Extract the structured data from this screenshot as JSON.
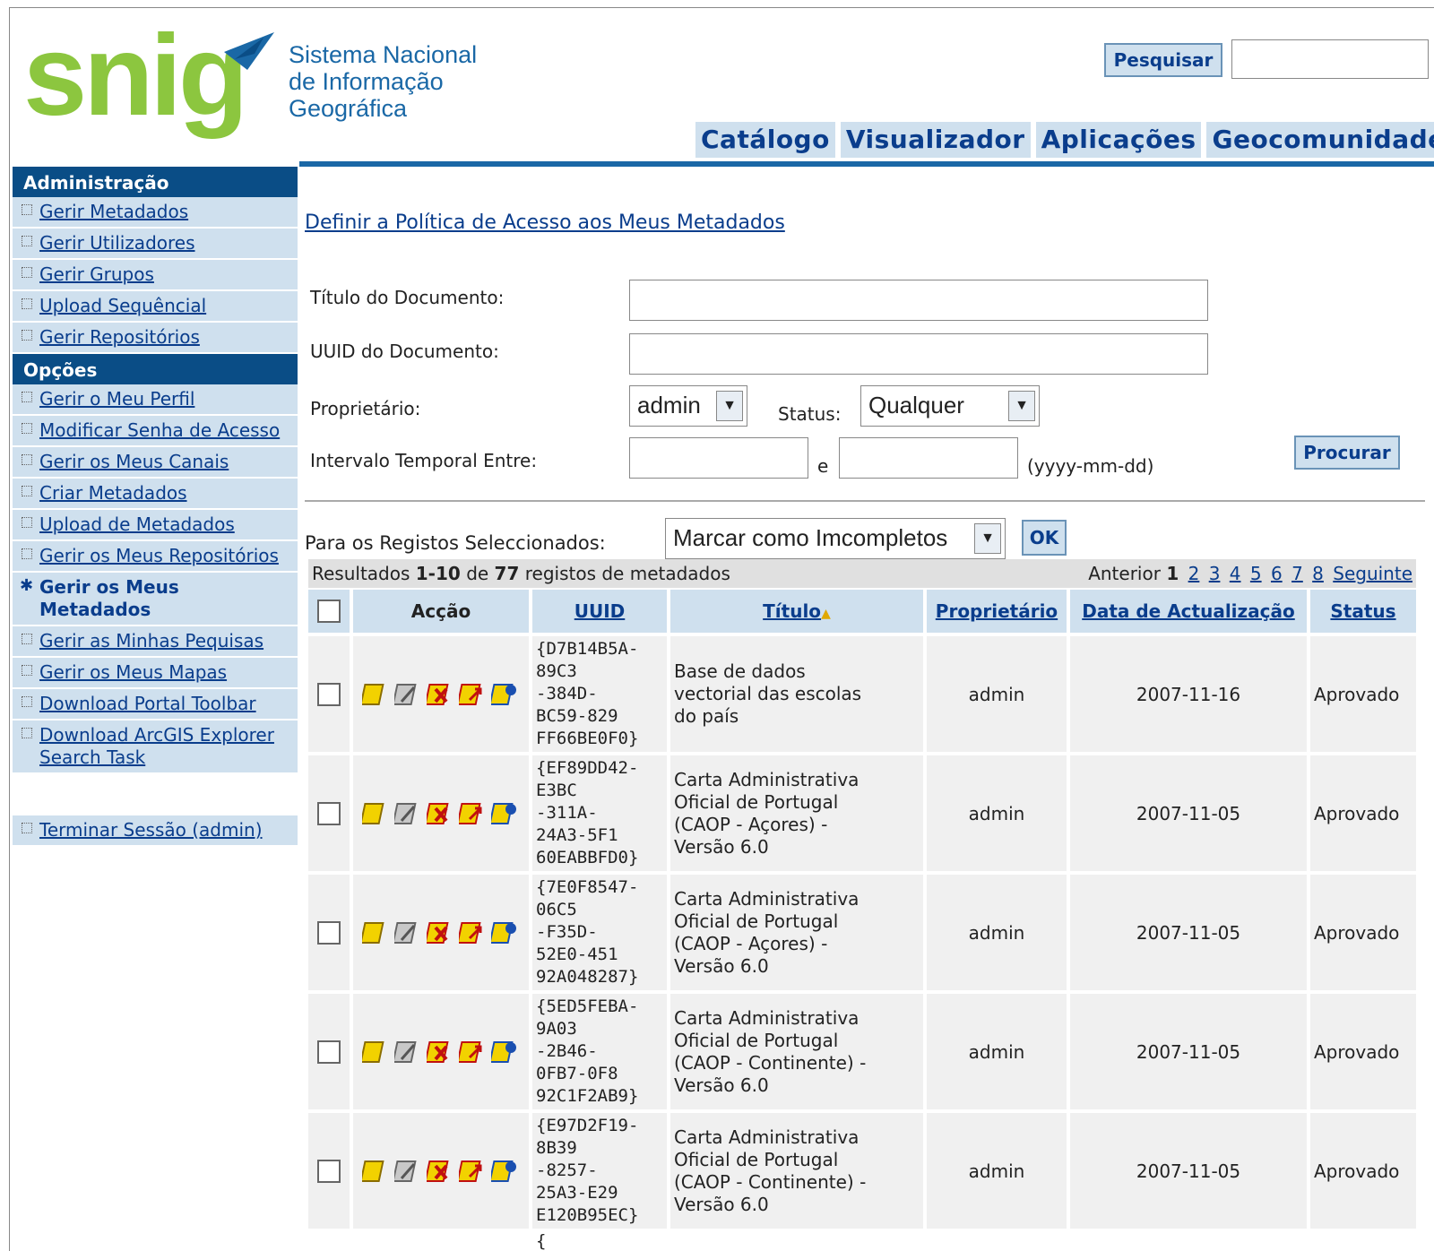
{
  "header": {
    "logo_text": "snig",
    "logo_sub": [
      "Sistema Nacional",
      "de Informação",
      "Geográfica"
    ],
    "search_button": "Pesquisar",
    "nav": [
      "Catálogo",
      "Visualizador",
      "Aplicações",
      "Geocomunidade"
    ]
  },
  "sidebar": {
    "admin_heading": "Administração",
    "admin_items": [
      "Gerir Metadados",
      "Gerir Utilizadores",
      "Gerir Grupos",
      "Upload Sequêncial",
      "Gerir Repositórios"
    ],
    "options_heading": "Opções",
    "option_items": [
      "Gerir o Meu Perfil",
      "Modificar Senha de Acesso",
      "Gerir os Meus Canais",
      "Criar Metadados",
      "Upload de Metadados",
      "Gerir os Meus Repositórios",
      "Gerir os Meus Metadados",
      "Gerir as Minhas Pequisas",
      "Gerir os Meus Mapas",
      "Download Portal Toolbar",
      "Download ArcGIS Explorer Search Task"
    ],
    "logout": "Terminar Sessão (admin)"
  },
  "main": {
    "policy_link": "Definir a Política de Acesso aos Meus Metadados",
    "form": {
      "title_label": "Título do Documento:",
      "uuid_label": "UUID do Documento:",
      "owner_label": "Proprietário:",
      "owner_value": "admin",
      "status_label": "Status:",
      "status_value": "Qualquer",
      "interval_label": "Intervalo Temporal Entre:",
      "and": "e",
      "date_hint": "(yyyy-mm-dd)",
      "find_button": "Procurar"
    },
    "bulk": {
      "label": "Para os Registos Seleccionados:",
      "action_value": "Marcar como Imcompletos",
      "ok": "OK"
    },
    "results": {
      "prefix": "Resultados",
      "range": "1-10",
      "of": "de",
      "total": "77",
      "suffix": "registos de metadados",
      "prev": "Anterior",
      "current_page": "1",
      "pages": [
        "2",
        "3",
        "4",
        "5",
        "6",
        "7",
        "8"
      ],
      "next": "Seguinte"
    },
    "table": {
      "headers": {
        "action": "Acção",
        "uuid": "UUID",
        "title": "Título",
        "owner": "Proprietário",
        "date": "Data de Actualização",
        "status": "Status"
      },
      "rows": [
        {
          "uuid": [
            "{D7B14B5A-",
            "89C3",
            "-384D-",
            "BC59-829",
            "FF66BE0F0}"
          ],
          "title": [
            "Base de dados",
            "vectorial das escolas",
            "do país"
          ],
          "owner": "admin",
          "date": "2007-11-16",
          "status": "Aprovado"
        },
        {
          "uuid": [
            "{EF89DD42-",
            "E3BC",
            "-311A-",
            "24A3-5F1",
            "60EABBFD0}"
          ],
          "title": [
            "Carta Administrativa",
            "Oficial de Portugal",
            "(CAOP - Açores) -",
            "Versão 6.0"
          ],
          "owner": "admin",
          "date": "2007-11-05",
          "status": "Aprovado"
        },
        {
          "uuid": [
            "{7E0F8547-",
            "06C5",
            "-F35D-",
            "52E0-451",
            "92A048287}"
          ],
          "title": [
            "Carta Administrativa",
            "Oficial de Portugal",
            "(CAOP - Açores) -",
            "Versão 6.0"
          ],
          "owner": "admin",
          "date": "2007-11-05",
          "status": "Aprovado"
        },
        {
          "uuid": [
            "{5ED5FEBA-",
            "9A03",
            "-2B46-",
            "0FB7-0F8",
            "92C1F2AB9}"
          ],
          "title": [
            "Carta Administrativa",
            "Oficial de Portugal",
            "(CAOP - Continente) -",
            "Versão 6.0"
          ],
          "owner": "admin",
          "date": "2007-11-05",
          "status": "Aprovado"
        },
        {
          "uuid": [
            "{E97D2F19-",
            "8B39",
            "-8257-",
            "25A3-E29",
            "E120B95EC}"
          ],
          "title": [
            "Carta Administrativa",
            "Oficial de Portugal",
            "(CAOP - Continente) -",
            "Versão 6.0"
          ],
          "owner": "admin",
          "date": "2007-11-05",
          "status": "Aprovado"
        }
      ],
      "partial_next": "{"
    }
  },
  "colors": {
    "brand_green": "#8cc63f",
    "brand_blue": "#1a68a6",
    "dark_blue": "#0a4d86",
    "light_blue": "#cfe0ee"
  }
}
